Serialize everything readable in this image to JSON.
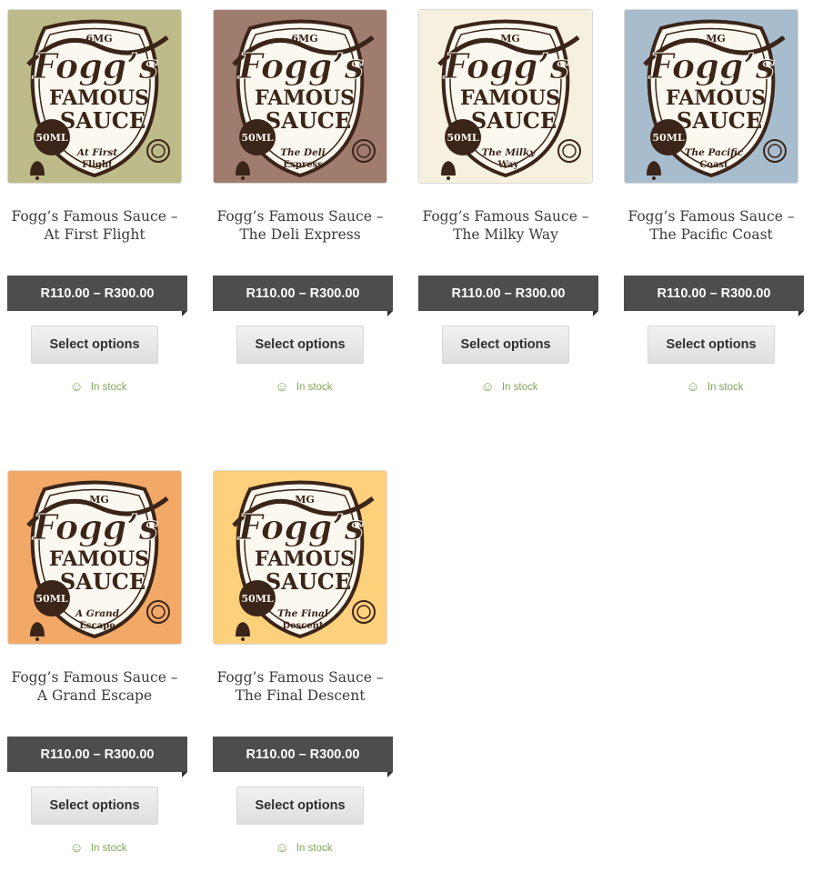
{
  "products": [
    {
      "title": "Fogg’s Famous Sauce – At First Flight",
      "price": "R110.00 – R300.00",
      "button": "Select options",
      "stock": "In stock",
      "flavor_label": "At First Flight",
      "strength": "6MG",
      "bg": "#bdbb89",
      "volume": "50ML",
      "brand": "Fogg’s",
      "brand2": "FAMOUS",
      "brand3": "SAUCE"
    },
    {
      "title": "Fogg’s Famous Sauce – The Deli Express",
      "price": "R110.00 – R300.00",
      "button": "Select options",
      "stock": "In stock",
      "flavor_label": "The Deli Express",
      "strength": "6MG",
      "bg": "#a07c6f",
      "volume": "50ML",
      "brand": "Fogg’s",
      "brand2": "FAMOUS",
      "brand3": "SAUCE"
    },
    {
      "title": "Fogg’s Famous Sauce – The Milky Way",
      "price": "R110.00 – R300.00",
      "button": "Select options",
      "stock": "In stock",
      "flavor_label": "The Milky Way",
      "strength": "MG",
      "bg": "#f6f1df",
      "volume": "50ML",
      "brand": "Fogg’s",
      "brand2": "FAMOUS",
      "brand3": "SAUCE"
    },
    {
      "title": "Fogg’s Famous Sauce – The Pacific Coast",
      "price": "R110.00 – R300.00",
      "button": "Select options",
      "stock": "In stock",
      "flavor_label": "The Pacific Coast",
      "strength": "MG",
      "bg": "#a7bdcd",
      "volume": "50ML",
      "brand": "Fogg’s",
      "brand2": "FAMOUS",
      "brand3": "SAUCE"
    },
    {
      "title": "Fogg’s Famous Sauce – A Grand Escape",
      "price": "R110.00 – R300.00",
      "button": "Select options",
      "stock": "In stock",
      "flavor_label": "A Grand Escape",
      "strength": "MG",
      "bg": "#f2a968",
      "volume": "50ML",
      "brand": "Fogg’s",
      "brand2": "FAMOUS",
      "brand3": "SAUCE"
    },
    {
      "title": "Fogg’s Famous Sauce – The Final Descent",
      "price": "R110.00 – R300.00",
      "button": "Select options",
      "stock": "In stock",
      "flavor_label": "The Final Descent",
      "strength": "MG",
      "bg": "#fdd07c",
      "volume": "50ML",
      "brand": "Fogg’s",
      "brand2": "FAMOUS",
      "brand3": "SAUCE"
    }
  ],
  "icons": {
    "stock": "smiley-icon",
    "badge": "crest-icon",
    "bell": "bell-icon"
  },
  "colors": {
    "price_bg": "#4d4d4d",
    "stock_text": "#7fa65a",
    "logo_brown": "#3b2418",
    "label_cream": "#fbf8ef"
  }
}
